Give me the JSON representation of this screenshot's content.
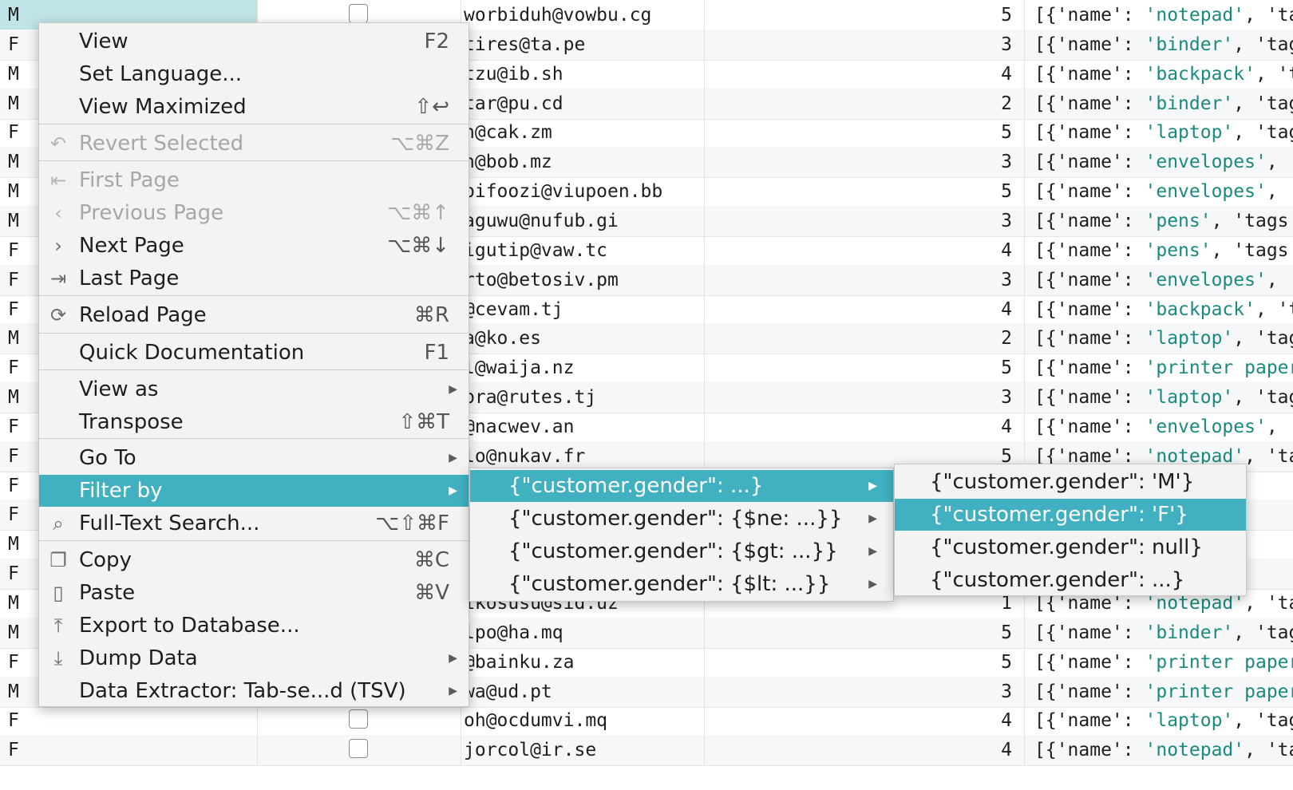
{
  "grid": {
    "rows": [
      {
        "gender": "M",
        "email": "worbiduh@vowbu.cg",
        "qty": "5",
        "item": "notepad",
        "tail": ", 'ta"
      },
      {
        "gender": "F",
        "email": "tires@ta.pe",
        "qty": "3",
        "item": "binder",
        "tail": ", 'tag"
      },
      {
        "gender": "M",
        "email": "tzu@ib.sh",
        "qty": "4",
        "item": "backpack",
        "tail": ", 't"
      },
      {
        "gender": "M",
        "email": "tar@pu.cd",
        "qty": "2",
        "item": "binder",
        "tail": ", 'tag"
      },
      {
        "gender": "F",
        "email": "n@cak.zm",
        "qty": "5",
        "item": "laptop",
        "tail": ", 'tag"
      },
      {
        "gender": "M",
        "email": "n@bob.mz",
        "qty": "3",
        "item": "envelopes",
        "tail": ", '"
      },
      {
        "gender": "M",
        "email": "pifoozi@viupoen.bb",
        "qty": "5",
        "item": "envelopes",
        "tail": ", '"
      },
      {
        "gender": "M",
        "email": "aguwu@nufub.gi",
        "qty": "3",
        "item": "pens",
        "tail": ", 'tags"
      },
      {
        "gender": "F",
        "email": "igutip@vaw.tc",
        "qty": "4",
        "item": "pens",
        "tail": ", 'tags"
      },
      {
        "gender": "F",
        "email": "rto@betosiv.pm",
        "qty": "3",
        "item": "envelopes",
        "tail": ", '"
      },
      {
        "gender": "F",
        "email": "@cevam.tj",
        "qty": "4",
        "item": "backpack",
        "tail": ", 't"
      },
      {
        "gender": "M",
        "email": "a@ko.es",
        "qty": "2",
        "item": "laptop",
        "tail": ", 'tag"
      },
      {
        "gender": "F",
        "email": "l@waija.nz",
        "qty": "5",
        "item": "printer paper",
        "tail": ""
      },
      {
        "gender": "M",
        "email": "pra@rutes.tj",
        "qty": "3",
        "item": "laptop",
        "tail": ", 'tag"
      },
      {
        "gender": "F",
        "email": "@nacwev.an",
        "qty": "4",
        "item": "envelopes",
        "tail": ", '"
      },
      {
        "gender": "F",
        "email": "lo@nukav.fr",
        "qty": "5",
        "item": "notepad",
        "tail": ", 'ta"
      },
      {
        "gender": "F",
        "email": "",
        "qty": "",
        "item": "",
        "tail": ""
      },
      {
        "gender": "F",
        "email": "",
        "qty": "",
        "item": "",
        "tail": ""
      },
      {
        "gender": "M",
        "email": "",
        "qty": "",
        "item": "",
        "tail": ""
      },
      {
        "gender": "F",
        "email": "",
        "qty": "",
        "item": "",
        "tail": ""
      },
      {
        "gender": "M",
        "email": "ikosusu@sid.uz",
        "qty": "1",
        "item": "notepad",
        "tail": ", 'ta"
      },
      {
        "gender": "M",
        "email": "lpo@ha.mq",
        "qty": "5",
        "item": "binder",
        "tail": ", 'tag"
      },
      {
        "gender": "F",
        "email": "@bainku.za",
        "qty": "5",
        "item": "printer paper",
        "tail": ""
      },
      {
        "gender": "M",
        "email": "wa@ud.pt",
        "qty": "3",
        "item": "printer paper",
        "tail": ""
      },
      {
        "gender": "F",
        "email": "oh@ocdumvi.mq",
        "qty": "4",
        "item": "laptop",
        "tail": ", 'tag"
      },
      {
        "gender": "F",
        "email": "jorcol@ir.se",
        "qty": "4",
        "item": "notepad",
        "tail": ", 'ta"
      }
    ],
    "item_prefix": "[{'name': "
  },
  "context_menu": {
    "items": [
      {
        "label": "View",
        "shortcut": "F2",
        "icon": "",
        "state": "normal"
      },
      {
        "label": "Set Language...",
        "shortcut": "",
        "icon": "",
        "state": "normal"
      },
      {
        "label": "View Maximized",
        "shortcut": "⇧↩",
        "icon": "",
        "state": "normal"
      },
      {
        "label": "Revert Selected",
        "shortcut": "⌥⌘Z",
        "icon": "↶",
        "state": "disabled"
      },
      {
        "label": "First Page",
        "shortcut": "",
        "icon": "⇤",
        "state": "disabled"
      },
      {
        "label": "Previous Page",
        "shortcut": "⌥⌘↑",
        "icon": "‹",
        "state": "disabled"
      },
      {
        "label": "Next Page",
        "shortcut": "⌥⌘↓",
        "icon": "›",
        "state": "normal"
      },
      {
        "label": "Last Page",
        "shortcut": "",
        "icon": "⇥",
        "state": "normal"
      },
      {
        "label": "Reload Page",
        "shortcut": "⌘R",
        "icon": "⟳",
        "state": "normal"
      },
      {
        "label": "Quick Documentation",
        "shortcut": "F1",
        "icon": "",
        "state": "normal"
      },
      {
        "label": "View as",
        "shortcut": "",
        "icon": "",
        "state": "normal",
        "submenu": true
      },
      {
        "label": "Transpose",
        "shortcut": "⇧⌘T",
        "icon": "",
        "state": "normal"
      },
      {
        "label": "Go To",
        "shortcut": "",
        "icon": "",
        "state": "normal",
        "submenu": true
      },
      {
        "label": "Filter by",
        "shortcut": "",
        "icon": "",
        "state": "highlighted",
        "submenu": true
      },
      {
        "label": "Full-Text Search...",
        "shortcut": "⌥⇧⌘F",
        "icon": "⌕",
        "state": "normal"
      },
      {
        "label": "Copy",
        "shortcut": "⌘C",
        "icon": "❐",
        "state": "normal"
      },
      {
        "label": "Paste",
        "shortcut": "⌘V",
        "icon": "▯",
        "state": "normal"
      },
      {
        "label": "Export to Database...",
        "shortcut": "",
        "icon": "⤒",
        "state": "normal"
      },
      {
        "label": "Dump Data",
        "shortcut": "",
        "icon": "⤓",
        "state": "normal",
        "submenu": true
      },
      {
        "label": "Data Extractor: Tab-se...d (TSV)",
        "shortcut": "",
        "icon": "",
        "state": "normal",
        "submenu": true
      }
    ]
  },
  "filter_submenu": {
    "items": [
      {
        "label": "{\"customer.gender\": ...}",
        "state": "highlighted"
      },
      {
        "label": "{\"customer.gender\": {$ne: ...}}",
        "state": "normal"
      },
      {
        "label": "{\"customer.gender\": {$gt: ...}}",
        "state": "normal"
      },
      {
        "label": "{\"customer.gender\": {$lt: ...}}",
        "state": "normal"
      }
    ]
  },
  "value_submenu": {
    "items": [
      {
        "label": "{\"customer.gender\": 'M'}",
        "state": "normal"
      },
      {
        "label": "{\"customer.gender\": 'F'}",
        "state": "highlighted"
      },
      {
        "label": "{\"customer.gender\": null}",
        "state": "normal"
      },
      {
        "label": "{\"customer.gender\": ...}",
        "state": "normal"
      }
    ]
  },
  "colors": {
    "accent": "#41b0c1",
    "selection": "#bfe3e7",
    "string": "#1a8a7e"
  }
}
